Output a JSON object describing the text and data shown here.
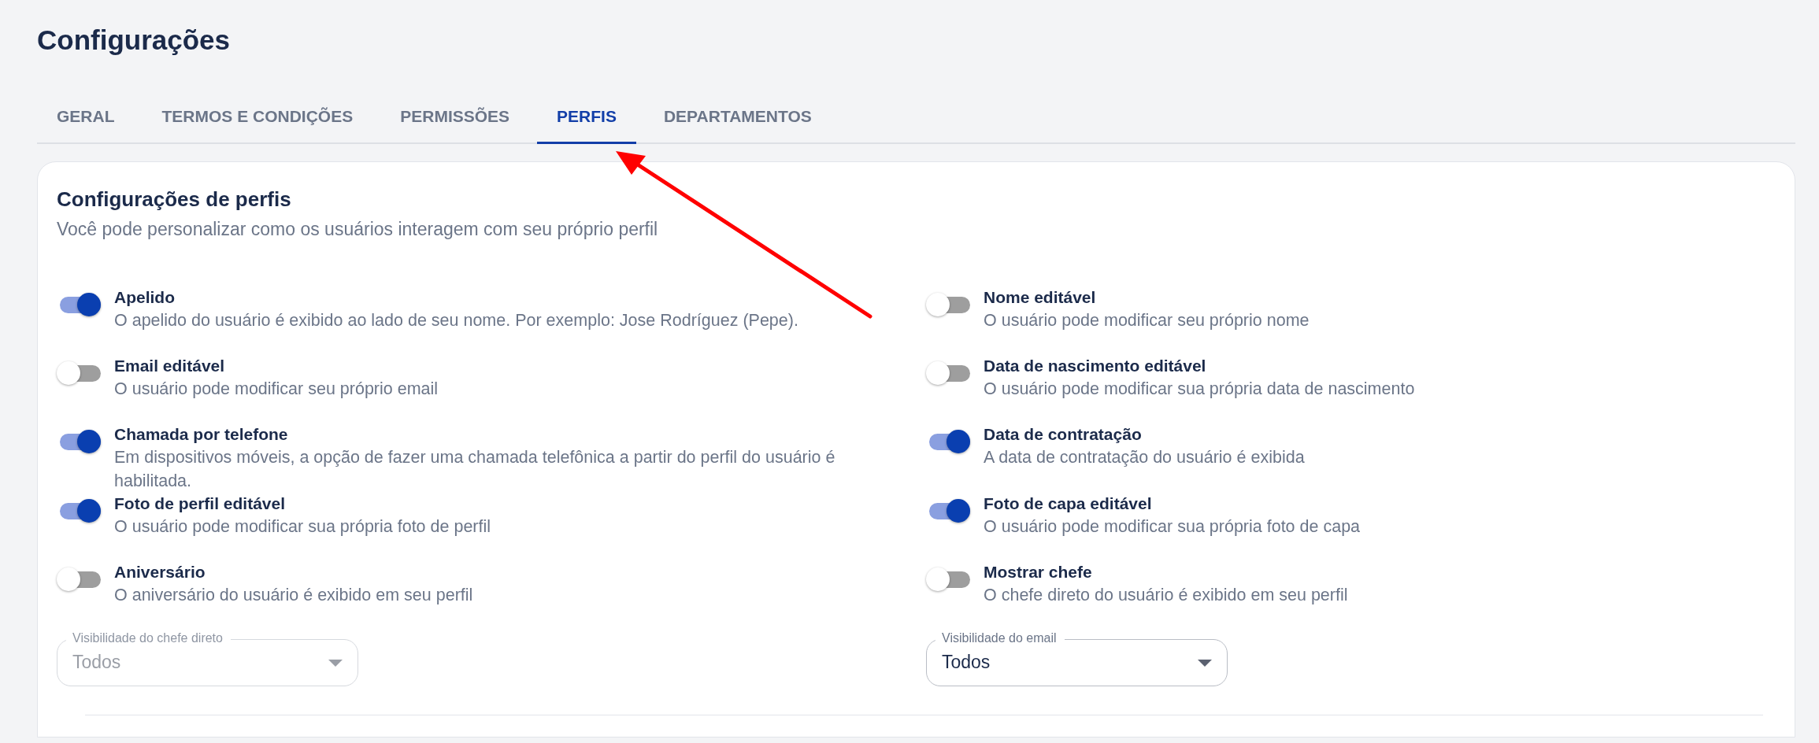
{
  "page": {
    "title": "Configurações"
  },
  "tabs": [
    {
      "label": "GERAL",
      "selected": false
    },
    {
      "label": "TERMOS E CONDIÇÕES",
      "selected": false
    },
    {
      "label": "PERMISSÕES",
      "selected": false
    },
    {
      "label": "PERFIS",
      "selected": true
    },
    {
      "label": "DEPARTAMENTOS",
      "selected": false
    }
  ],
  "card": {
    "title": "Configurações de perfis",
    "subtitle": "Você pode personalizar como os usuários interagem com seu próprio perfil",
    "settings": [
      {
        "label": "Apelido",
        "description": "O apelido do usuário é exibido ao lado de seu nome. Por exemplo: Jose Rodríguez (Pepe).",
        "on": true
      },
      {
        "label": "Nome editável",
        "description": "O usuário pode modificar seu próprio nome",
        "on": false
      },
      {
        "label": "Email editável",
        "description": "O usuário pode modificar seu próprio email",
        "on": false
      },
      {
        "label": "Data de nascimento editável",
        "description": "O usuário pode modificar sua própria data de nascimento",
        "on": false
      },
      {
        "label": "Chamada por telefone",
        "description": "Em dispositivos móveis, a opção de fazer uma chamada telefônica a partir do perfil do usuário é habilitada.",
        "on": true
      },
      {
        "label": "Data de contratação",
        "description": "A data de contratação do usuário é exibida",
        "on": true
      },
      {
        "label": "Foto de perfil editável",
        "description": "O usuário pode modificar sua própria foto de perfil",
        "on": true
      },
      {
        "label": "Foto de capa editável",
        "description": "O usuário pode modificar sua própria foto de capa",
        "on": true
      },
      {
        "label": "Aniversário",
        "description": "O aniversário do usuário é exibido em seu perfil",
        "on": false
      },
      {
        "label": "Mostrar chefe",
        "description": "O chefe direto do usuário é exibido em seu perfil",
        "on": false
      }
    ],
    "selects": [
      {
        "label": "Visibilidade do chefe direto",
        "value": "Todos",
        "disabled": true
      },
      {
        "label": "Visibilidade do email",
        "value": "Todos",
        "disabled": false
      }
    ]
  }
}
